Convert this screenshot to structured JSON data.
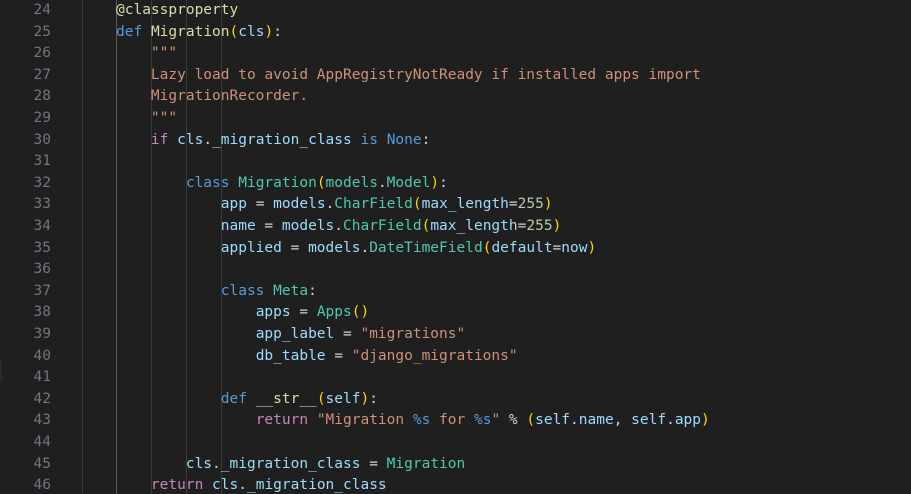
{
  "editor": {
    "language": "python",
    "line_numbers": [
      "24",
      "25",
      "26",
      "27",
      "28",
      "29",
      "30",
      "31",
      "32",
      "33",
      "34",
      "35",
      "36",
      "37",
      "38",
      "39",
      "40",
      "41",
      "42",
      "43",
      "44",
      "45",
      "46"
    ],
    "colors": {
      "background": "#1f1f1f",
      "line_number": "#6e7681",
      "keyword": "#569cd6",
      "control_keyword": "#c586c0",
      "function": "#dcdcaa",
      "class": "#4ec9b0",
      "variable": "#9cdcfe",
      "string": "#ce9178",
      "number": "#b5cea8",
      "bracket_level_1": "#ffd700",
      "bracket_level_2": "#da70d6"
    },
    "lines": [
      {
        "tokens": [
          {
            "t": "@classproperty",
            "c": "dec"
          }
        ]
      },
      {
        "tokens": [
          {
            "t": "def",
            "c": "kw"
          },
          {
            "t": " ",
            "c": "op"
          },
          {
            "t": "Migration",
            "c": "fn"
          },
          {
            "t": "(",
            "c": "b1"
          },
          {
            "t": "cls",
            "c": "var"
          },
          {
            "t": ")",
            "c": "b1"
          },
          {
            "t": ":",
            "c": "op"
          }
        ]
      },
      {
        "tokens": [
          {
            "t": "    \"\"\"",
            "c": "str"
          }
        ]
      },
      {
        "tokens": [
          {
            "t": "    Lazy load to avoid AppRegistryNotReady if installed apps import",
            "c": "str"
          }
        ]
      },
      {
        "tokens": [
          {
            "t": "    MigrationRecorder.",
            "c": "str"
          }
        ]
      },
      {
        "tokens": [
          {
            "t": "    \"\"\"",
            "c": "str"
          }
        ]
      },
      {
        "tokens": [
          {
            "t": "    ",
            "c": "op"
          },
          {
            "t": "if",
            "c": "kwc"
          },
          {
            "t": " ",
            "c": "op"
          },
          {
            "t": "cls",
            "c": "var"
          },
          {
            "t": ".",
            "c": "op"
          },
          {
            "t": "_migration_class",
            "c": "var"
          },
          {
            "t": " ",
            "c": "op"
          },
          {
            "t": "is",
            "c": "kw"
          },
          {
            "t": " ",
            "c": "op"
          },
          {
            "t": "None",
            "c": "kw"
          },
          {
            "t": ":",
            "c": "op"
          }
        ]
      },
      {
        "tokens": []
      },
      {
        "tokens": [
          {
            "t": "        ",
            "c": "op"
          },
          {
            "t": "class",
            "c": "kw"
          },
          {
            "t": " ",
            "c": "op"
          },
          {
            "t": "Migration",
            "c": "cls"
          },
          {
            "t": "(",
            "c": "b1"
          },
          {
            "t": "models",
            "c": "cls"
          },
          {
            "t": ".",
            "c": "op"
          },
          {
            "t": "Model",
            "c": "cls"
          },
          {
            "t": ")",
            "c": "b1"
          },
          {
            "t": ":",
            "c": "op"
          }
        ]
      },
      {
        "tokens": [
          {
            "t": "            ",
            "c": "op"
          },
          {
            "t": "app",
            "c": "var"
          },
          {
            "t": " = ",
            "c": "op"
          },
          {
            "t": "models",
            "c": "var"
          },
          {
            "t": ".",
            "c": "op"
          },
          {
            "t": "CharField",
            "c": "cls"
          },
          {
            "t": "(",
            "c": "b1"
          },
          {
            "t": "max_length",
            "c": "var"
          },
          {
            "t": "=",
            "c": "op"
          },
          {
            "t": "255",
            "c": "num"
          },
          {
            "t": ")",
            "c": "b1"
          }
        ]
      },
      {
        "tokens": [
          {
            "t": "            ",
            "c": "op"
          },
          {
            "t": "name",
            "c": "var"
          },
          {
            "t": " = ",
            "c": "op"
          },
          {
            "t": "models",
            "c": "var"
          },
          {
            "t": ".",
            "c": "op"
          },
          {
            "t": "CharField",
            "c": "cls"
          },
          {
            "t": "(",
            "c": "b1"
          },
          {
            "t": "max_length",
            "c": "var"
          },
          {
            "t": "=",
            "c": "op"
          },
          {
            "t": "255",
            "c": "num"
          },
          {
            "t": ")",
            "c": "b1"
          }
        ]
      },
      {
        "tokens": [
          {
            "t": "            ",
            "c": "op"
          },
          {
            "t": "applied",
            "c": "var"
          },
          {
            "t": " = ",
            "c": "op"
          },
          {
            "t": "models",
            "c": "var"
          },
          {
            "t": ".",
            "c": "op"
          },
          {
            "t": "DateTimeField",
            "c": "cls"
          },
          {
            "t": "(",
            "c": "b1"
          },
          {
            "t": "default",
            "c": "var"
          },
          {
            "t": "=",
            "c": "op"
          },
          {
            "t": "now",
            "c": "var"
          },
          {
            "t": ")",
            "c": "b1"
          }
        ]
      },
      {
        "tokens": []
      },
      {
        "tokens": [
          {
            "t": "            ",
            "c": "op"
          },
          {
            "t": "class",
            "c": "kw"
          },
          {
            "t": " ",
            "c": "op"
          },
          {
            "t": "Meta",
            "c": "cls"
          },
          {
            "t": ":",
            "c": "op"
          }
        ]
      },
      {
        "tokens": [
          {
            "t": "                ",
            "c": "op"
          },
          {
            "t": "apps",
            "c": "var"
          },
          {
            "t": " = ",
            "c": "op"
          },
          {
            "t": "Apps",
            "c": "cls"
          },
          {
            "t": "()",
            "c": "b1"
          }
        ]
      },
      {
        "tokens": [
          {
            "t": "                ",
            "c": "op"
          },
          {
            "t": "app_label",
            "c": "var"
          },
          {
            "t": " = ",
            "c": "op"
          },
          {
            "t": "\"migrations\"",
            "c": "str"
          }
        ]
      },
      {
        "tokens": [
          {
            "t": "                ",
            "c": "op"
          },
          {
            "t": "db_table",
            "c": "var"
          },
          {
            "t": " = ",
            "c": "op"
          },
          {
            "t": "\"django_migrations\"",
            "c": "str"
          }
        ]
      },
      {
        "tokens": []
      },
      {
        "tokens": [
          {
            "t": "            ",
            "c": "op"
          },
          {
            "t": "def",
            "c": "kw"
          },
          {
            "t": " ",
            "c": "op"
          },
          {
            "t": "__str__",
            "c": "fn"
          },
          {
            "t": "(",
            "c": "b1"
          },
          {
            "t": "self",
            "c": "var"
          },
          {
            "t": ")",
            "c": "b1"
          },
          {
            "t": ":",
            "c": "op"
          }
        ]
      },
      {
        "tokens": [
          {
            "t": "                ",
            "c": "op"
          },
          {
            "t": "return",
            "c": "kwc"
          },
          {
            "t": " ",
            "c": "op"
          },
          {
            "t": "\"Migration ",
            "c": "str"
          },
          {
            "t": "%s",
            "c": "fmt"
          },
          {
            "t": " for ",
            "c": "str"
          },
          {
            "t": "%s",
            "c": "fmt"
          },
          {
            "t": "\"",
            "c": "str"
          },
          {
            "t": " % ",
            "c": "op"
          },
          {
            "t": "(",
            "c": "b1"
          },
          {
            "t": "self",
            "c": "var"
          },
          {
            "t": ".",
            "c": "op"
          },
          {
            "t": "name",
            "c": "var"
          },
          {
            "t": ", ",
            "c": "op"
          },
          {
            "t": "self",
            "c": "var"
          },
          {
            "t": ".",
            "c": "op"
          },
          {
            "t": "app",
            "c": "var"
          },
          {
            "t": ")",
            "c": "b1"
          }
        ]
      },
      {
        "tokens": []
      },
      {
        "tokens": [
          {
            "t": "        ",
            "c": "op"
          },
          {
            "t": "cls",
            "c": "var"
          },
          {
            "t": ".",
            "c": "op"
          },
          {
            "t": "_migration_class",
            "c": "var"
          },
          {
            "t": " = ",
            "c": "op"
          },
          {
            "t": "Migration",
            "c": "cls"
          }
        ]
      },
      {
        "tokens": [
          {
            "t": "    ",
            "c": "op"
          },
          {
            "t": "return",
            "c": "kwc"
          },
          {
            "t": " ",
            "c": "op"
          },
          {
            "t": "cls",
            "c": "var"
          },
          {
            "t": ".",
            "c": "op"
          },
          {
            "t": "_migration_class",
            "c": "var"
          }
        ]
      }
    ]
  }
}
